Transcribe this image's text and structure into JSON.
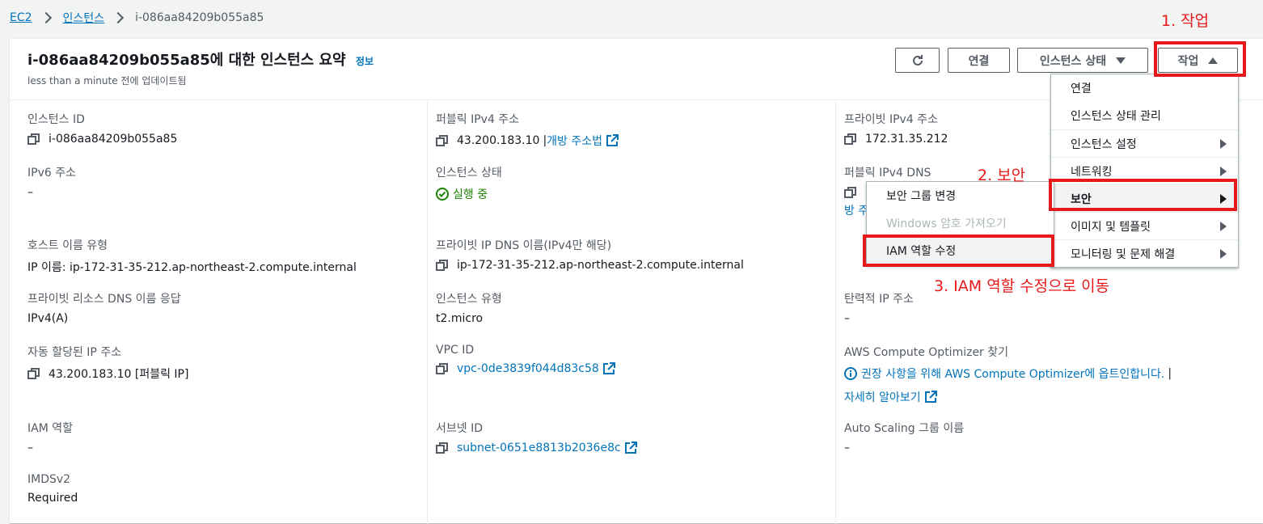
{
  "breadcrumb": {
    "items": [
      "EC2",
      "인스턴스"
    ],
    "current": "i-086aa84209b055a85"
  },
  "header": {
    "title": "i-086aa84209b055a85에 대한 인스턴스 요약",
    "info_link": "정보",
    "subtitle": "less than a minute 전에 업데이트됨",
    "buttons": {
      "connect": "연결",
      "instance_state": "인스턴스 상태",
      "actions": "작업"
    }
  },
  "details": {
    "col1": [
      {
        "label": "인스턴스 ID",
        "value": "i-086aa84209b055a85"
      },
      {
        "label": "IPv6 주소",
        "value": "–"
      },
      {
        "label": "호스트 이름 유형",
        "value": "IP 이름: ip-172-31-35-212.ap-northeast-2.compute.internal"
      },
      {
        "label": "프라이빗 리소스 DNS 이름 응답",
        "value": "IPv4(A)"
      },
      {
        "label": "자동 할당된 IP 주소",
        "value": "43.200.183.10 [퍼블릭 IP]"
      },
      {
        "label": "IAM 역할",
        "value": "–"
      },
      {
        "label": "IMDSv2",
        "value": "Required"
      }
    ],
    "col2": [
      {
        "label": "퍼블릭 IPv4 주소",
        "value": "43.200.183.10",
        "sep": "|",
        "link": "개방 주소법"
      },
      {
        "label": "인스턴스 상태",
        "value": "실행 중"
      },
      {
        "label": "프라이빗 IP DNS 이름(IPv4만 해당)",
        "value": "ip-172-31-35-212.ap-northeast-2.compute.internal"
      },
      {
        "label": "인스턴스 유형",
        "value": "t2.micro"
      },
      {
        "label": "VPC ID",
        "value": "vpc-0de3839f044d83c58"
      },
      {
        "label": "서브넷 ID",
        "value": "subnet-0651e8813b2036e8c"
      }
    ],
    "col3": [
      {
        "label": "프라이빗 IPv4 주소",
        "value": "172.31.35.212"
      },
      {
        "label": "퍼블릭 IPv4 DNS",
        "partial": "방 주"
      },
      {
        "label": "탄력적 IP 주소",
        "value": "–"
      },
      {
        "label": "AWS Compute Optimizer 찾기",
        "link_line1": "권장 사항을 위해 AWS Compute Optimizer에 옵트인합니다.",
        "sep": "|",
        "link_line2": "자세히 알아보기"
      },
      {
        "label": "Auto Scaling 그룹 이름",
        "value": "–"
      }
    ]
  },
  "actions_menu": {
    "items": [
      "연결",
      "인스턴스 상태 관리",
      "인스턴스 설정",
      "네트워킹",
      "보안",
      "이미지 및 템플릿",
      "모니터링 및 문제 해결"
    ]
  },
  "security_submenu": {
    "items": [
      "보안 그룹 변경",
      "Windows 암호 가져오기",
      "IAM 역할 수정"
    ]
  },
  "annotations": {
    "step1": "1. 작업",
    "step2": "2. 보안",
    "step3": "3. IAM 역할 수정으로 이동"
  },
  "colors": {
    "link": "#0073bb",
    "success": "#1d8102",
    "annotation": "#e8191b"
  }
}
